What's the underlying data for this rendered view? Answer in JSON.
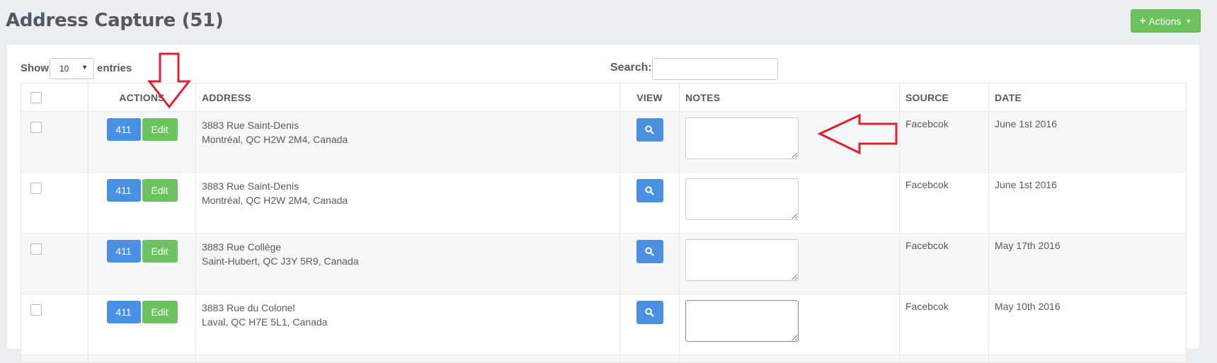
{
  "page": {
    "title": "Address Capture (51)"
  },
  "header": {
    "actions_label": "Actions"
  },
  "controls": {
    "show_label": "Show",
    "page_length": "10",
    "entries_label": "entries",
    "search_label": "Search:",
    "search_value": ""
  },
  "table": {
    "columns": [
      "ACTIONS",
      "ADDRESS",
      "VIEW",
      "NOTES",
      "SOURCE",
      "DATE"
    ],
    "rows": [
      {
        "btn_411": "411",
        "btn_edit": "Edit",
        "address_line1": "3883 Rue Saint-Denis",
        "address_line2": "Montréal, QC H2W 2M4, Canada",
        "notes": "",
        "source": "Facebcok",
        "date": "June 1st 2016"
      },
      {
        "btn_411": "411",
        "btn_edit": "Edit",
        "address_line1": "3883 Rue Saint-Denis",
        "address_line2": "Montréal, QC H2W 2M4, Canada",
        "notes": "",
        "source": "Facebcok",
        "date": "June 1st 2016"
      },
      {
        "btn_411": "411",
        "btn_edit": "Edit",
        "address_line1": "3883 Rue Collège",
        "address_line2": "Saint-Hubert, QC J3Y 5R9, Canada",
        "notes": "",
        "source": "Facebcok",
        "date": "May 17th 2016"
      },
      {
        "btn_411": "411",
        "btn_edit": "Edit",
        "address_line1": "3883 Rue du Colonel",
        "address_line2": "Laval, QC H7E 5L1, Canada",
        "notes": "",
        "source": "Facebcok",
        "date": "May 10th 2016"
      }
    ]
  },
  "colors": {
    "blue_button": "#4a90e2",
    "green_button": "#6cc25e",
    "annotation_arrow": "#e0202a"
  },
  "icons": {
    "view": "search-icon",
    "annotation": "red-arrow-icon"
  }
}
